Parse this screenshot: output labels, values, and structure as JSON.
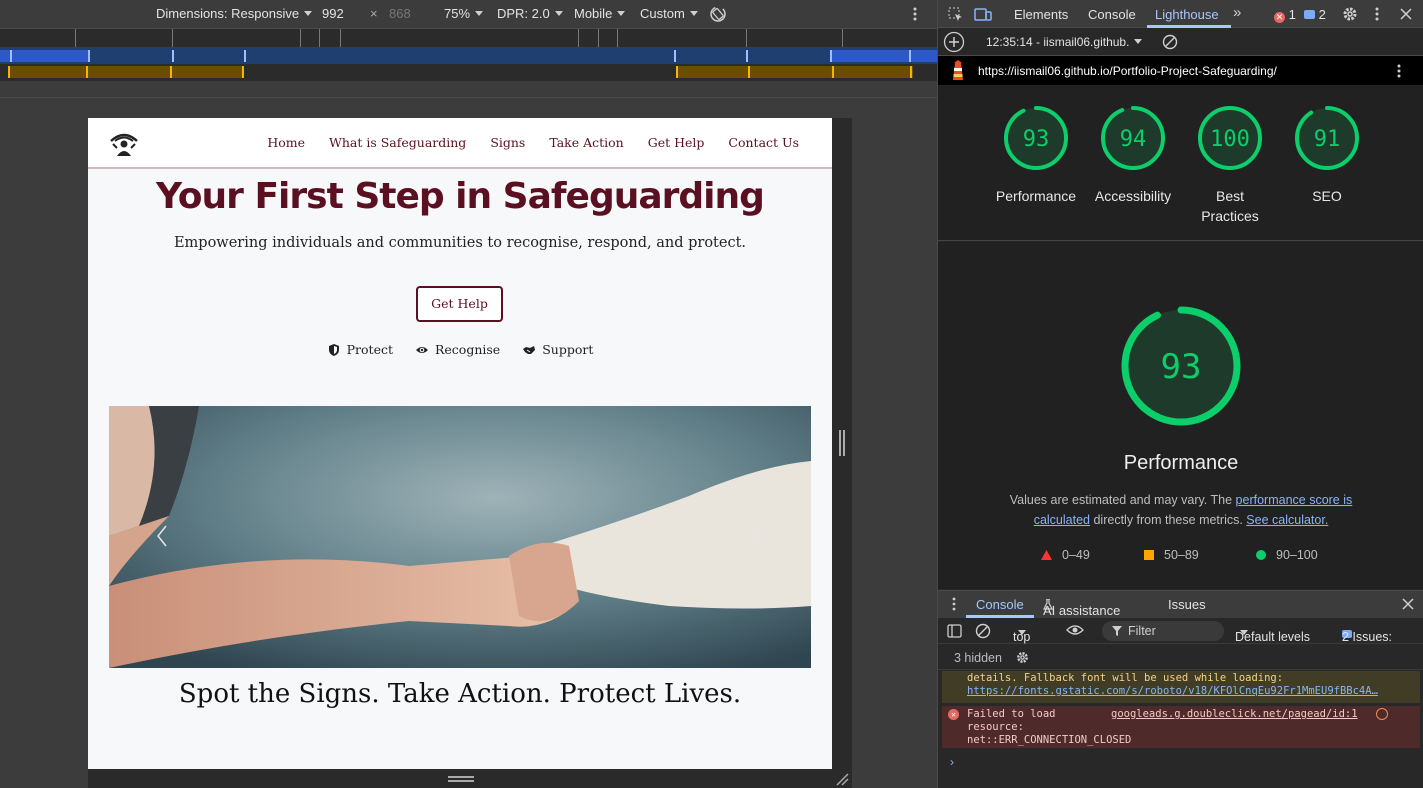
{
  "device_toolbar": {
    "dimensions_label": "Dimensions: Responsive",
    "width": "992",
    "times": "×",
    "height": "868",
    "zoom": "75%",
    "dpr": "DPR: 2.0",
    "device_mode": "Mobile",
    "throttle": "Custom"
  },
  "site": {
    "nav": [
      "Home",
      "What is Safeguarding",
      "Signs",
      "Take Action",
      "Get Help",
      "Contact Us"
    ],
    "hero_title": "Your First Step in Safeguarding",
    "hero_subtitle": "Empowering individuals and communities to recognise, respond, and protect.",
    "cta_label": "Get Help",
    "pills": [
      "Protect",
      "Recognise",
      "Support"
    ],
    "tagline": "Spot the Signs. Take Action. Protect Lives."
  },
  "devtools": {
    "tabs": [
      "Elements",
      "Console",
      "Lighthouse"
    ],
    "active_tab": "Lighthouse",
    "more": "»",
    "errors": "1",
    "messages": "2",
    "report_time": "12:35:14 - iismail06.github.",
    "url": "https://iismail06.github.io/Portfolio-Project-Safeguarding/",
    "scores": [
      {
        "label": "Performance",
        "value": 93
      },
      {
        "label": "Accessibility",
        "value": 94
      },
      {
        "label": "Best Practices",
        "value": 100
      },
      {
        "label": "SEO",
        "value": 91
      }
    ],
    "main_score": 93,
    "main_title": "Performance",
    "desc_prefix": "Values are estimated and may vary. The ",
    "desc_link1": "performance score is calculated",
    "desc_mid": " directly from these metrics. ",
    "desc_link2": "See calculator.",
    "legend": [
      "0–49",
      "50–89",
      "90–100"
    ],
    "colors": {
      "good": "#0cce6b",
      "average": "#ffa400",
      "fail": "#ff3333"
    }
  },
  "console": {
    "tabs": [
      "Console",
      "AI assistance",
      "Issues"
    ],
    "context": "top",
    "filter_placeholder": "Filter",
    "levels": "Default levels",
    "issues_label": "2 Issues:",
    "issues_count": "2",
    "hidden": "3 hidden",
    "warn_line1": "details. Fallback font will be used while loading:",
    "warn_link": "https://fonts.gstatic.com/s/roboto/v18/KFOlCnqEu92Fr1MmEU9fBBc4A…",
    "err_line1": "Failed to load",
    "err_line2": "resource:",
    "err_line3": "net::ERR_CONNECTION_CLOSED",
    "err_source": "googleads.g.doubleclick.net/pagead/id:1",
    "prompt": "›"
  }
}
